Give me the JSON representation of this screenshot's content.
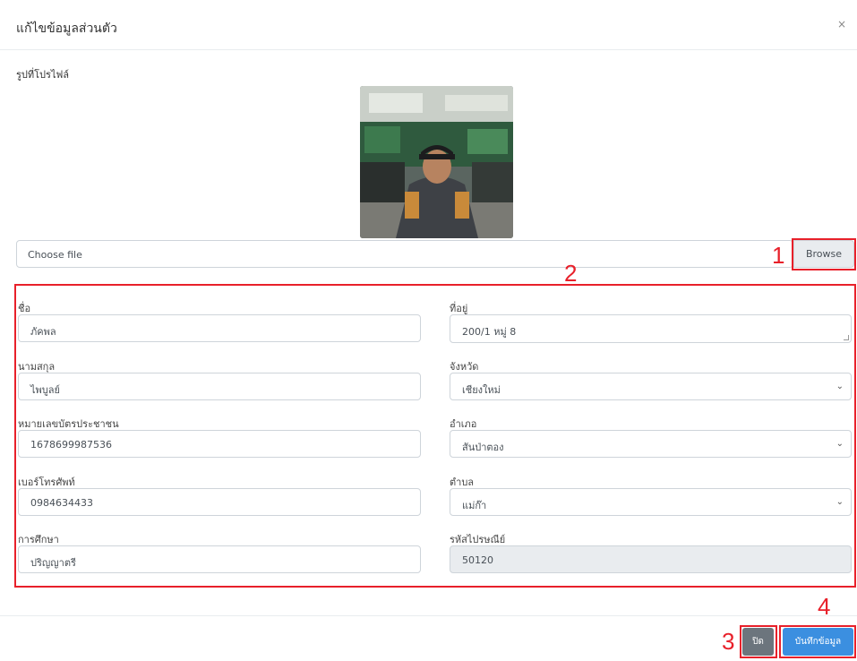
{
  "modal": {
    "title": "แก้ไขข้อมูลส่วนตัว",
    "close_symbol": "×"
  },
  "profile": {
    "label": "รูปที่โปรไฟล์",
    "photo_icon": "profile-photo"
  },
  "file_upload": {
    "placeholder": "Choose file",
    "browse_label": "Browse"
  },
  "annotations": {
    "one": "1",
    "two": "2",
    "three": "3",
    "four": "4",
    "color": "#e8202a"
  },
  "form": {
    "first_name": {
      "label": "ชื่อ",
      "value": "ภัคพล"
    },
    "last_name": {
      "label": "นามสกุล",
      "value": "ไพบูลย์"
    },
    "id_card": {
      "label": "หมายเลขบัตรประชาชน",
      "value": "1678699987536"
    },
    "phone": {
      "label": "เบอร์โทรศัพท์",
      "value": "0984634433"
    },
    "education": {
      "label": "การศึกษา",
      "value": "ปริญญาตรี"
    },
    "address": {
      "label": "ที่อยู่",
      "value": "200/1 หมู่ 8"
    },
    "province": {
      "label": "จังหวัด",
      "value": "เชียงใหม่"
    },
    "district": {
      "label": "อำเภอ",
      "value": "สันป่าตอง"
    },
    "subdistrict": {
      "label": "ตำบล",
      "value": "แม่ก๊า"
    },
    "postal_code": {
      "label": "รหัสไปรษณีย์",
      "value": "50120"
    }
  },
  "footer": {
    "close_label": "ปิด",
    "save_label": "บันทึกข้อมูล",
    "close_color": "#6c757d",
    "save_color": "#3b8fe0"
  }
}
